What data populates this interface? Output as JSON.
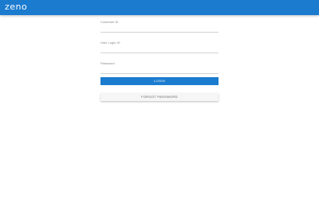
{
  "header": {
    "logo_text": "zeno",
    "background_color": "#1b7bcf"
  },
  "form": {
    "fields": [
      {
        "label": "Customer ID",
        "value": "",
        "placeholder": ""
      },
      {
        "label": "User Login ID",
        "value": "",
        "placeholder": ""
      },
      {
        "label": "Password",
        "value": "",
        "placeholder": ""
      }
    ],
    "login_label": "LOGIN",
    "forgot_label": "FORGOT PASSWORD"
  }
}
